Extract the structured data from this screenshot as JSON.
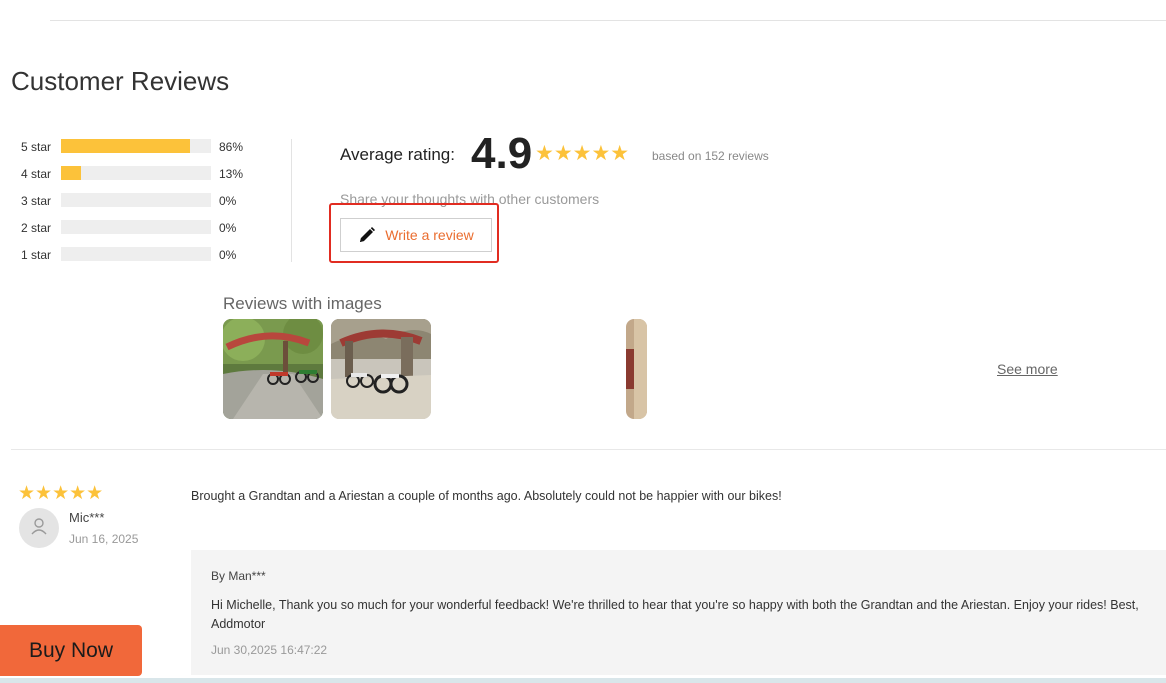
{
  "section_title": "Customer Reviews",
  "distribution": [
    {
      "label": "5 star",
      "percent": 86,
      "percent_text": "86%"
    },
    {
      "label": "4 star",
      "percent": 13,
      "percent_text": "13%"
    },
    {
      "label": "3 star",
      "percent": 0,
      "percent_text": "0%"
    },
    {
      "label": "2 star",
      "percent": 0,
      "percent_text": "0%"
    },
    {
      "label": "1 star",
      "percent": 0,
      "percent_text": "0%"
    }
  ],
  "summary": {
    "average_label": "Average rating:",
    "average_value": "4.9",
    "stars": "★★★★★",
    "based_on": "based on 152 reviews",
    "share_prompt": "Share your thoughts with other customers",
    "write_button": "Write a review"
  },
  "reviews_with_images": {
    "title": "Reviews with images",
    "see_more": "See more"
  },
  "review": {
    "stars": "★★★★★",
    "author": "Mic***",
    "date": "Jun 16, 2025",
    "text": "Brought a Grandtan and a Ariestan a couple of months ago.  Absolutely could not be happier with our bikes!",
    "reply": {
      "by": "By Man***",
      "text": "Hi Michelle,  Thank you so much for your wonderful feedback! We're thrilled to hear that you're so happy with both the Grandtan and the Ariestan. Enjoy your rides!  Best,\nAddmotor",
      "time": "Jun 30,2025 16:47:22"
    }
  },
  "buy_now": "Buy Now",
  "colors": {
    "star": "#fcc23a",
    "accent": "#ea6d2f",
    "buy_button": "#f1683a",
    "highlight": "#e12c21"
  }
}
